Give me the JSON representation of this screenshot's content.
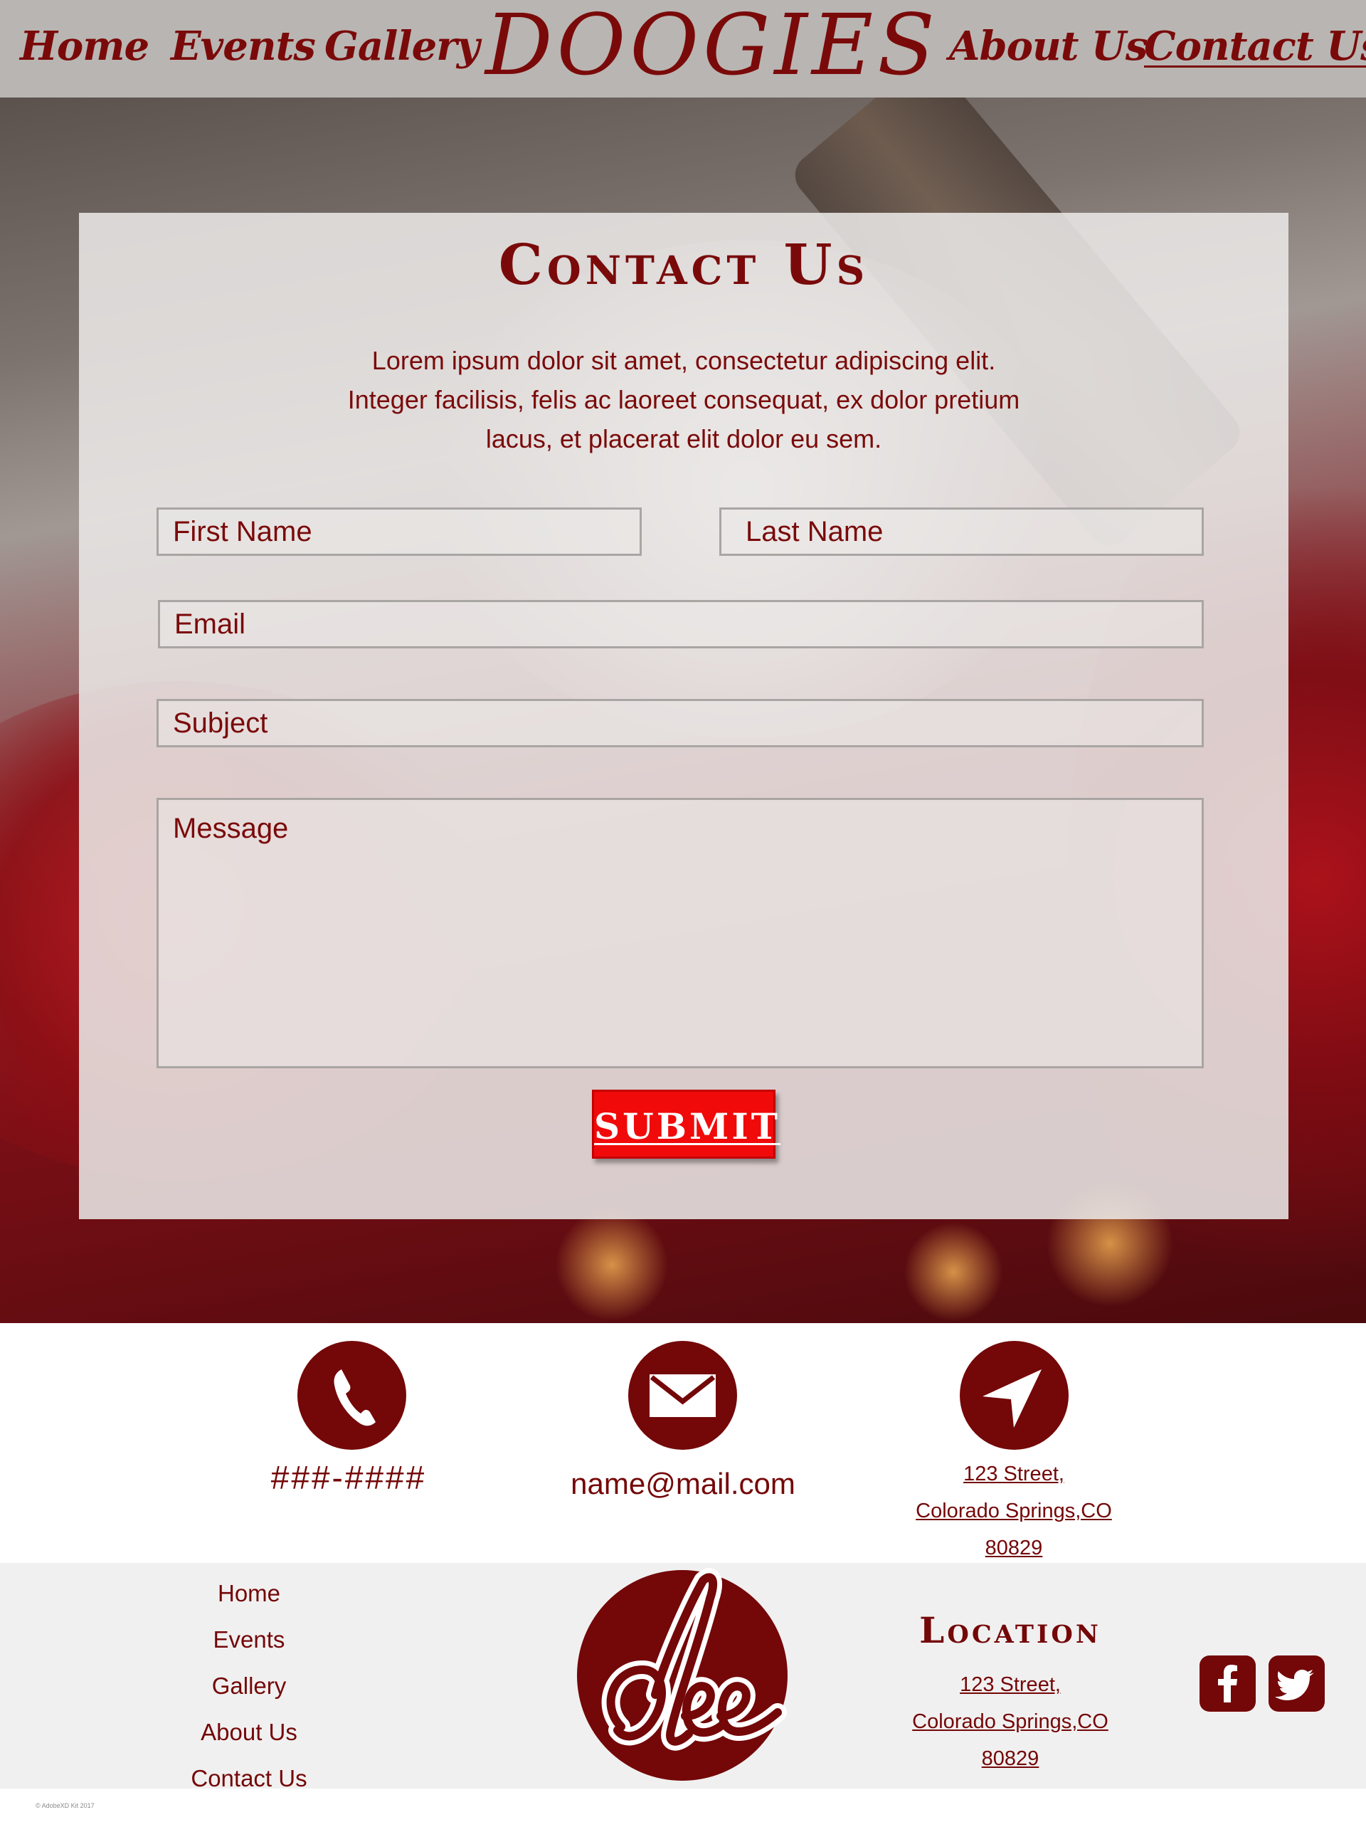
{
  "nav": {
    "home": "Home",
    "events": "Events",
    "gallery": "Gallery",
    "brand": "DOOGIES",
    "about": "About Us",
    "contact": "Contact Us"
  },
  "contact_form": {
    "title": "Contact Us",
    "intro_line1": "Lorem ipsum dolor sit amet, consectetur adipiscing elit.",
    "intro_line2": "Integer facilisis, felis ac laoreet consequat, ex dolor pretium",
    "intro_line3": "lacus, et placerat elit dolor eu sem.",
    "first_name": "First Name",
    "last_name": "Last Name",
    "email": "Email",
    "subject": "Subject",
    "message": "Message",
    "submit": "SUBMIT"
  },
  "info": {
    "phone_icon": "phone-icon",
    "mail_icon": "mail-icon",
    "location_icon": "location-arrow-icon",
    "phone": "###-####",
    "email": "name@mail.com",
    "address_line1": "123 Street,",
    "address_line2": "Colorado Springs,CO",
    "address_line3": "80829"
  },
  "footer": {
    "links": [
      "Home",
      "Events",
      "Gallery",
      "About Us",
      "Contact Us"
    ],
    "logo_text": "dee",
    "location_title": "Location",
    "address_line1": "123 Street,",
    "address_line2": "Colorado Springs,CO",
    "address_line3": "80829",
    "social": [
      "facebook-icon",
      "twitter-icon"
    ],
    "copyright": "© AdobeXD Kit 2017"
  },
  "colors": {
    "brand": "#740708",
    "nav_bg": "#b9b5b2",
    "submit_bg": "#f00a0a",
    "footer_bg": "#f1f0f0"
  }
}
